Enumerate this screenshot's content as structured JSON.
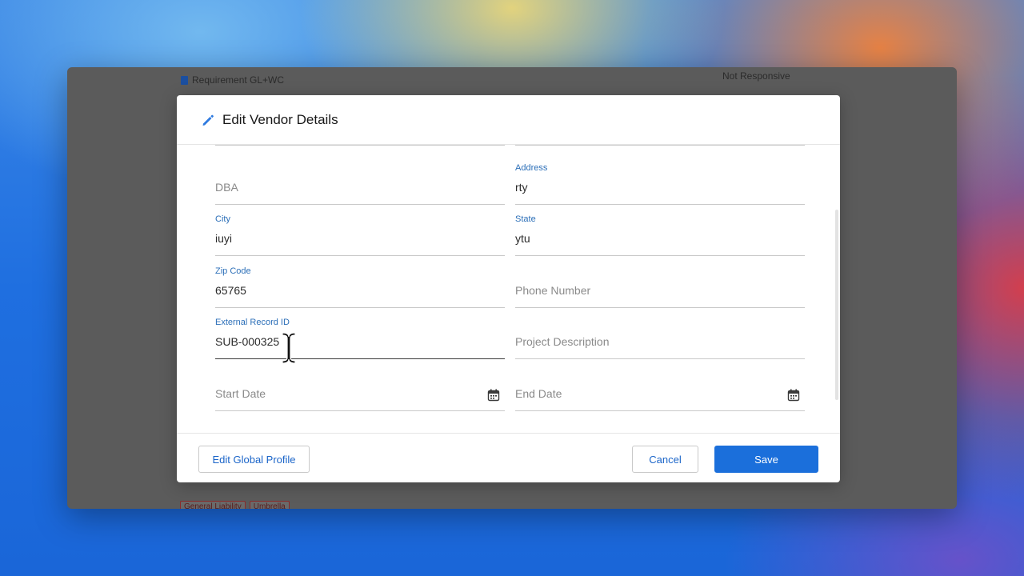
{
  "background": {
    "requirement_label": "Requirement GL+WC",
    "status_label": "Not Responsive",
    "tags": [
      "General Liability",
      "Umbrella"
    ]
  },
  "modal": {
    "title": "Edit Vendor Details",
    "fields": {
      "dba": {
        "label": "",
        "placeholder": "DBA",
        "value": ""
      },
      "address": {
        "label": "Address",
        "value": "rty"
      },
      "city": {
        "label": "City",
        "value": "iuyi"
      },
      "state": {
        "label": "State",
        "value": "ytu"
      },
      "zip_code": {
        "label": "Zip Code",
        "value": "65765"
      },
      "phone_number": {
        "placeholder": "Phone Number",
        "value": ""
      },
      "external_record_id": {
        "label": "External Record ID",
        "value": "SUB-000325"
      },
      "project_description": {
        "placeholder": "Project Description",
        "value": ""
      },
      "start_date": {
        "placeholder": "Start Date",
        "value": ""
      },
      "end_date": {
        "placeholder": "End Date",
        "value": ""
      }
    },
    "footer": {
      "edit_global_profile": "Edit Global Profile",
      "cancel": "Cancel",
      "save": "Save"
    }
  },
  "colors": {
    "accent": "#1b6fdb",
    "label": "#2c6fb8",
    "overlay": "#5b5b5b"
  },
  "icons": {
    "header": "pencil-icon",
    "date": "calendar-icon",
    "cursor": "text-cursor-icon"
  }
}
